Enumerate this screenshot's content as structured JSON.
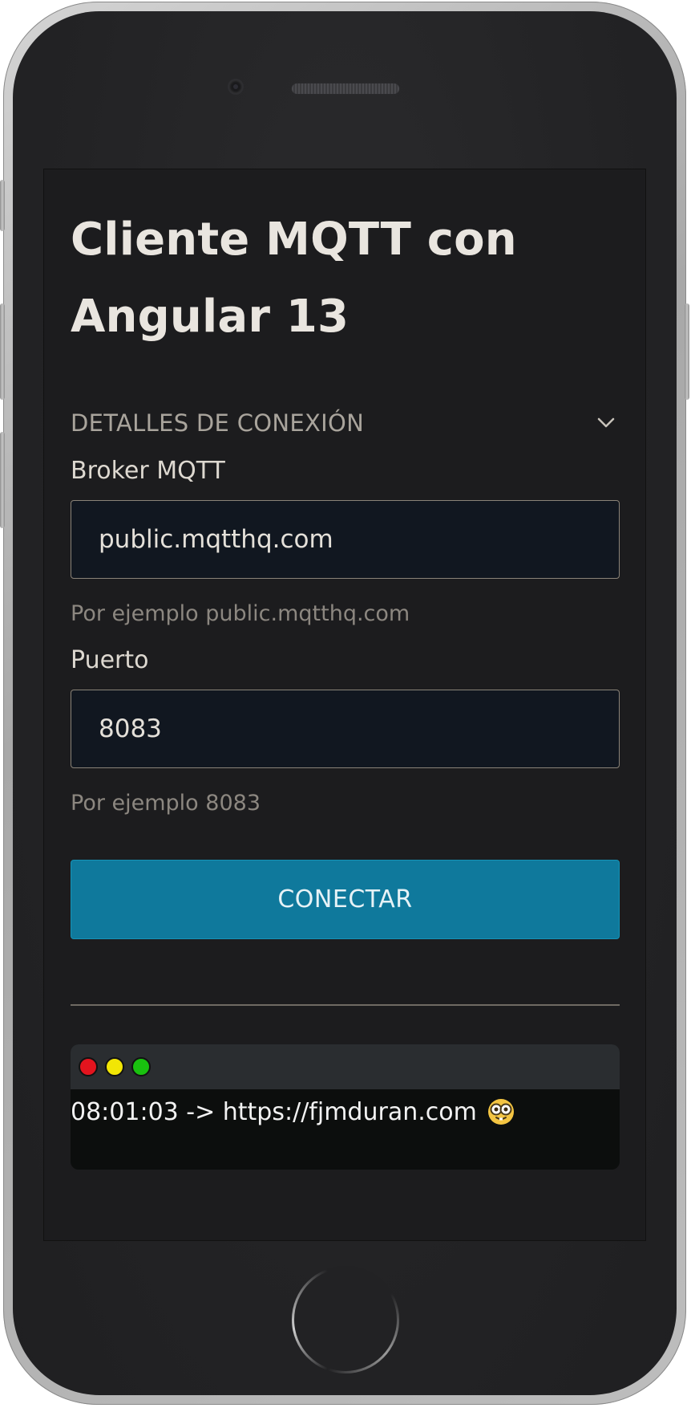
{
  "app": {
    "title": "Cliente MQTT con Angular 13"
  },
  "connection_section": {
    "title": "DETALLES DE CONEXIÓN",
    "expand_icon": "chevron-down-icon"
  },
  "broker_field": {
    "label": "Broker MQTT",
    "value": "public.mqtthq.com",
    "hint": "Por ejemplo public.mqtthq.com"
  },
  "port_field": {
    "label": "Puerto",
    "value": "8083",
    "hint": "Por ejemplo 8083"
  },
  "connect_button": {
    "label": "CONECTAR",
    "color": "#0f799c"
  },
  "terminal": {
    "dots": [
      {
        "name": "close",
        "color": "#e3141e"
      },
      {
        "name": "minimize",
        "color": "#f2e605"
      },
      {
        "name": "maximize",
        "color": "#19c10f"
      }
    ],
    "log_line": "08:01:03 -> https://fjmduran.com",
    "log_icon": "nerd-face-emoji"
  },
  "colors": {
    "screen_background": "#1c1c1e",
    "input_background": "#111720",
    "terminal_bar": "#2a2d30",
    "terminal_body": "#0c0e0d"
  }
}
